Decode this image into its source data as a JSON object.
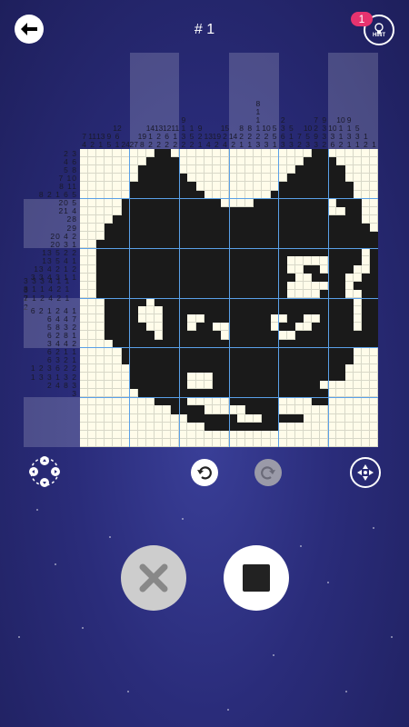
{
  "header": {
    "title": "# 1",
    "hint_label": "HINT",
    "hint_count": "1"
  },
  "colors": {
    "background": "#2a2c7a",
    "board": "#fffcea",
    "filled": "#1a1a1a",
    "grid_line": "#5aa0e8",
    "badge": "#e6336f"
  },
  "puzzle": {
    "size": 36,
    "column_clues": [
      [
        "7",
        "4"
      ],
      [
        "11",
        "2"
      ],
      [
        "13",
        "1"
      ],
      [
        "9",
        "5"
      ],
      [
        "12",
        "6",
        "1"
      ],
      [
        "24"
      ],
      [
        "27"
      ],
      [
        "19",
        "8"
      ],
      [
        "14",
        "1",
        "2"
      ],
      [
        "13",
        "2",
        "2"
      ],
      [
        "12",
        "6",
        "2"
      ],
      [
        "11",
        "1",
        "2"
      ],
      [
        "9",
        "1",
        "3",
        "2"
      ],
      [
        "1",
        "5",
        "2"
      ],
      [
        "9",
        "2",
        "1"
      ],
      [
        "13",
        "4"
      ],
      [
        "19",
        "2"
      ],
      [
        "15",
        "2",
        "4"
      ],
      [
        "14",
        "2"
      ],
      [
        "8",
        "2",
        "1"
      ],
      [
        "8",
        "2",
        "1"
      ],
      [
        "8",
        "1",
        "1",
        "1",
        "2",
        "3"
      ],
      [
        "10",
        "2",
        "3"
      ],
      [
        "5",
        "5",
        "1"
      ],
      [
        "2",
        "3",
        "6",
        "3"
      ],
      [
        "5",
        "1",
        "3"
      ],
      [
        "7",
        "2"
      ],
      [
        "10",
        "5",
        "3"
      ],
      [
        "7",
        "2",
        "9",
        "3"
      ],
      [
        "9",
        "3",
        "3",
        "2"
      ],
      [
        "10",
        "3",
        "6"
      ],
      [
        "10",
        "1",
        "1",
        "2"
      ],
      [
        "9",
        "1",
        "3",
        "1"
      ],
      [
        "5",
        "3",
        "1"
      ],
      [
        "1",
        "2"
      ],
      [
        "1"
      ]
    ],
    "row_clues": [
      [
        "2",
        "3"
      ],
      [
        "4",
        "6"
      ],
      [
        "5",
        "8"
      ],
      [
        "7",
        "10"
      ],
      [
        "8",
        "11"
      ],
      [
        "8",
        "2",
        "1",
        "6",
        "5"
      ],
      [
        "20",
        "5"
      ],
      [
        "21",
        "4"
      ],
      [
        "28"
      ],
      [
        "29"
      ],
      [
        "20",
        "4",
        "2"
      ],
      [
        "20",
        "3",
        "1"
      ],
      [
        "13",
        "5",
        "2",
        "2"
      ],
      [
        "13",
        "5",
        "4",
        "1"
      ],
      [
        "13",
        "4",
        "2",
        "1",
        "2"
      ],
      [
        "3",
        "3",
        "4",
        "3",
        "1",
        "1"
      ],
      [
        "3",
        "3",
        "3",
        "4",
        "1",
        "1",
        "3"
      ],
      [
        "8",
        "1",
        "1",
        "4",
        "2",
        "1",
        "2"
      ],
      [
        "7",
        "1",
        "2",
        "4",
        "2",
        "1",
        "2"
      ],
      [
        "6",
        "2",
        "1",
        "2",
        "4",
        "1"
      ],
      [
        "6",
        "4",
        "4",
        "7"
      ],
      [
        "5",
        "8",
        "3",
        "2"
      ],
      [
        "6",
        "2",
        "8",
        "1"
      ],
      [
        "3",
        "4",
        "4",
        "2"
      ],
      [
        "6",
        "2",
        "1",
        "1"
      ],
      [
        "6",
        "3",
        "2",
        "1"
      ],
      [
        "1",
        "2",
        "3",
        "6",
        "2",
        "2"
      ],
      [
        "1",
        "3",
        "3",
        "1",
        "3",
        "2"
      ],
      [
        "2",
        "4",
        "8",
        "3"
      ],
      [
        "3"
      ],
      [
        "",
        "",
        ""
      ],
      [
        "",
        "",
        ""
      ],
      [
        "",
        "",
        ""
      ],
      [
        "",
        "",
        ""
      ],
      [
        "",
        "",
        ""
      ],
      [
        "",
        "",
        ""
      ]
    ],
    "grid": [
      "000000000110000000000000000011000000",
      "000000001111000000000000000111100000",
      "000000011111000000000000001111110000",
      "000000011111100000000000011111110000",
      "000000111111110000000000111111111000",
      "000000111111111000000001111111111000",
      "000001111111111110000111111111011100",
      "000001111111111111111111111111001100",
      "000011111111111111111111111111111100",
      "000111111111111111111111111111111110",
      "000111111111111111111111111111111111",
      "001111111111111111111111111111111111",
      "001111111111111111111111111111111101",
      "001111111111111111111111100000111101",
      "001111111111111111111111100110111001",
      "001111111111111111111111110011110011",
      "001111111111111111111111100000110111",
      "001111111111111111111111100001110011",
      "000111110111111111111111111111111011",
      "000111100011111111111111111111111011",
      "000111100011100111111110011001111011",
      "000111110011101100111110110011111011",
      "000111111011111110111111001111111111",
      "000011111111111111111111111111111111",
      "000001111111111111111111111111111000",
      "000001111111111111111111111111111000",
      "000000111111111111111111111111110000",
      "000000111111100011111111111111110000",
      "000000111111100011111111111110000000",
      "000000011111111111111111111111000000",
      "000000000111100000111111000011000000",
      "000000000001111000001111000000000000",
      "000000000000011111100011111000000000",
      "000000000000000111111111000000000000",
      "000000000000000000000000000000000000",
      "000000000000000000000000000000000000"
    ]
  }
}
